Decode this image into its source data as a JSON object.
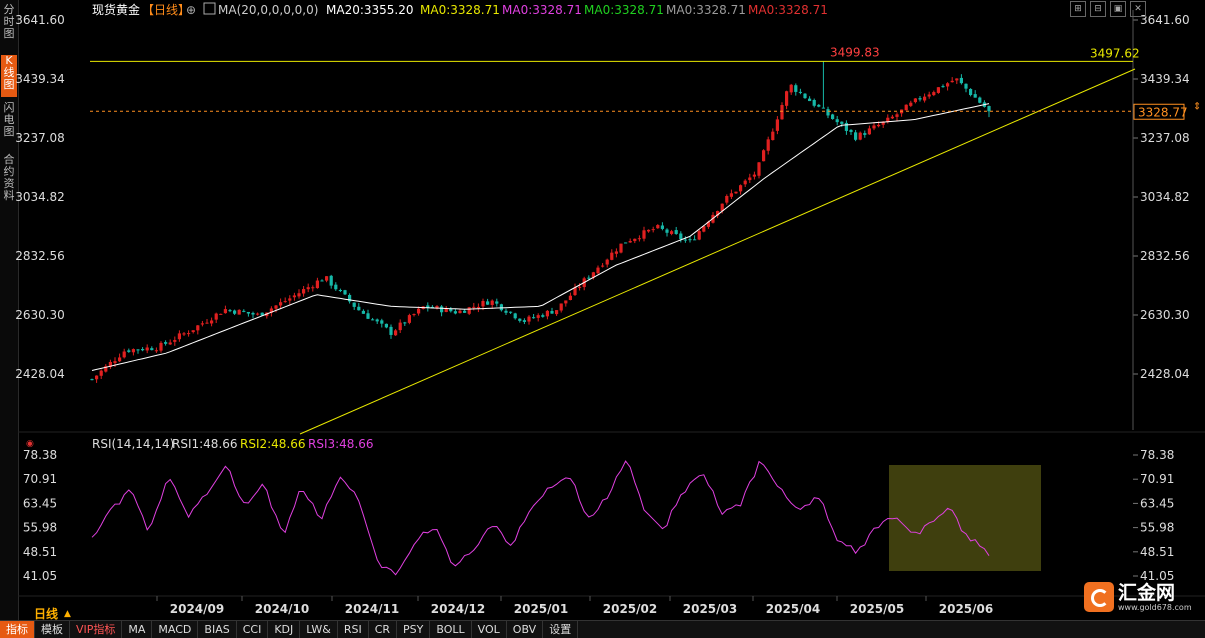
{
  "left_tabs": [
    {
      "label": "分时图",
      "active": false
    },
    {
      "label": "K线图",
      "active": true
    },
    {
      "label": "闪电图",
      "active": false
    },
    {
      "label": "合约资料",
      "active": false
    }
  ],
  "header": {
    "instrument": "现货黄金",
    "period": "【日线】",
    "ma_params": "MA(20,0,0,0,0,0)",
    "ma_items": [
      {
        "text": "MA20:3355.20",
        "color": "#ffffff"
      },
      {
        "text": "MA0:3328.71",
        "color": "#e8e800"
      },
      {
        "text": "MA0:3328.71",
        "color": "#e040e0"
      },
      {
        "text": "MA0:3328.71",
        "color": "#20d020"
      },
      {
        "text": "MA0:3328.71",
        "color": "#9a9a9a"
      },
      {
        "text": "MA0:3328.71",
        "color": "#e03030"
      }
    ]
  },
  "window_controls": [
    "⊞",
    "⊟",
    "▣",
    "✕"
  ],
  "price_axis": {
    "ticks": [
      "3641.60",
      "3439.34",
      "3237.08",
      "3034.82",
      "2832.56",
      "2630.30",
      "2428.04"
    ]
  },
  "price_annotations": {
    "high": "3499.83",
    "trendline_end": "3497.62",
    "current": "3328.77"
  },
  "rsi_header": {
    "label": "RSI(14,14,14)",
    "items": [
      {
        "text": "RSI1:48.66",
        "color": "#dddddd"
      },
      {
        "text": "RSI2:48.66",
        "color": "#e8e800"
      },
      {
        "text": "RSI3:48.66",
        "color": "#e040e0"
      }
    ]
  },
  "rsi_axis": {
    "ticks": [
      "78.38",
      "70.91",
      "63.45",
      "55.98",
      "48.51",
      "41.05"
    ]
  },
  "x_axis": {
    "labels": [
      "2024/09",
      "2024/10",
      "2024/11",
      "2024/12",
      "2025/01",
      "2025/02",
      "2025/03",
      "2025/04",
      "2025/05",
      "2025/06"
    ]
  },
  "period_label": "日线",
  "bottom_toolbar": [
    "指标",
    "模板",
    "VIP指标",
    "MA",
    "MACD",
    "BIAS",
    "CCI",
    "KDJ",
    "LW&",
    "RSI",
    "CR",
    "PSY",
    "BOLL",
    "VOL",
    "OBV",
    "设置"
  ],
  "logo": {
    "name": "汇金网",
    "url": "www.gold678.com"
  },
  "colors": {
    "up": "#e02020",
    "down": "#16b8a8",
    "ma": "#ffffff",
    "trend": "#e8e800",
    "rsi": "#e040e0",
    "highlight": "#4a4a10"
  },
  "chart_data": {
    "type": "candlestick",
    "price_ylim": [
      2428.04,
      3641.6
    ],
    "ma_period": 20,
    "months": [
      "2024/09",
      "2024/10",
      "2024/11",
      "2024/12",
      "2025/01",
      "2025/02",
      "2025/03",
      "2025/04",
      "2025/05",
      "2025/06"
    ],
    "close_path_estimate": [
      [
        "2024/08",
        2410
      ],
      [
        "2024/08",
        2510
      ],
      [
        "2024/09",
        2520
      ],
      [
        "2024/09",
        2580
      ],
      [
        "2024/09",
        2650
      ],
      [
        "2024/10",
        2630
      ],
      [
        "2024/10",
        2690
      ],
      [
        "2024/10",
        2760
      ],
      [
        "2024/11",
        2650
      ],
      [
        "2024/11",
        2570
      ],
      [
        "2024/11",
        2660
      ],
      [
        "2024/12",
        2640
      ],
      [
        "2024/12",
        2680
      ],
      [
        "2024/12",
        2610
      ],
      [
        "2025/01",
        2650
      ],
      [
        "2025/01",
        2770
      ],
      [
        "2025/02",
        2880
      ],
      [
        "2025/02",
        2930
      ],
      [
        "2025/03",
        2880
      ],
      [
        "2025/03",
        3020
      ],
      [
        "2025/04",
        3120
      ],
      [
        "2025/04",
        3420
      ],
      [
        "2025/04",
        3330
      ],
      [
        "2025/05",
        3240
      ],
      [
        "2025/05",
        3300
      ],
      [
        "2025/06",
        3380
      ],
      [
        "2025/06",
        3440
      ],
      [
        "2025/06",
        3329
      ]
    ],
    "ma20_path_estimate": [
      [
        "2024/08",
        2440
      ],
      [
        "2024/09",
        2500
      ],
      [
        "2024/10",
        2600
      ],
      [
        "2024/11",
        2700
      ],
      [
        "2024/11",
        2660
      ],
      [
        "2024/12",
        2650
      ],
      [
        "2025/01",
        2660
      ],
      [
        "2025/02",
        2800
      ],
      [
        "2025/03",
        2900
      ],
      [
        "2025/04",
        3100
      ],
      [
        "2025/04",
        3280
      ],
      [
        "2025/05",
        3300
      ],
      [
        "2025/06",
        3355
      ]
    ],
    "period_high": 3499.83,
    "current_price": 3328.77,
    "trendline_label_value": 3497.62,
    "rsi": {
      "ylim": [
        41.05,
        78.38
      ],
      "values_estimate": [
        52,
        62,
        68,
        55,
        72,
        60,
        66,
        75,
        62,
        70,
        54,
        68,
        58,
        72,
        64,
        45,
        42,
        52,
        56,
        44,
        49,
        58,
        50,
        62,
        68,
        72,
        58,
        65,
        77,
        61,
        55,
        68,
        73,
        60,
        64,
        77,
        68,
        61,
        66,
        53,
        48,
        56,
        60,
        54,
        58,
        62,
        52,
        48.66
      ],
      "current": 48.66
    }
  }
}
